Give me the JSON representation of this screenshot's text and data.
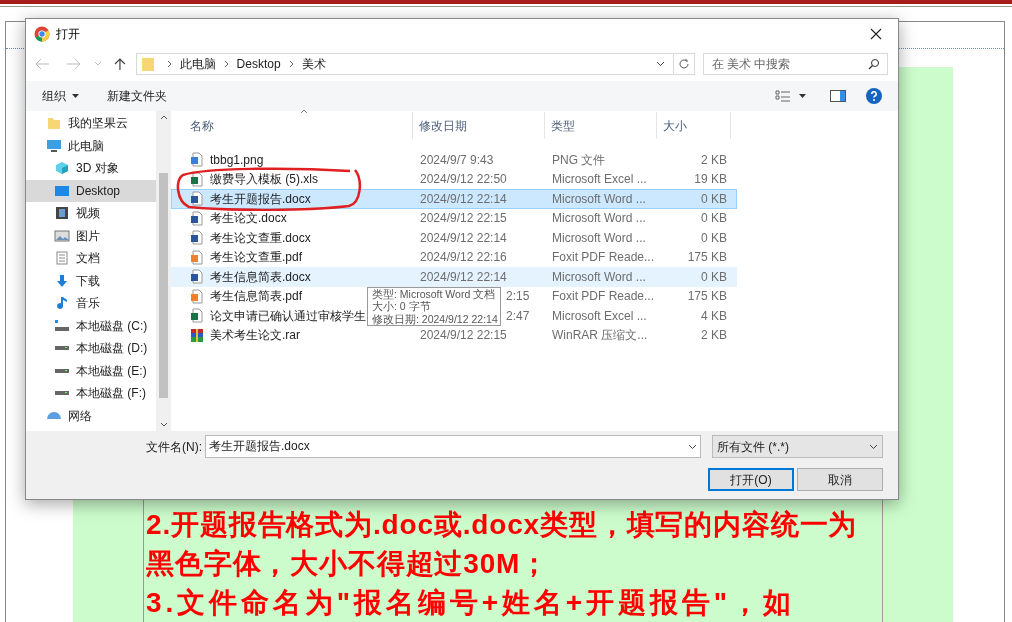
{
  "page": {
    "paragraphs": [
      {
        "text": "2.开题报告格式为.doc或.docx类型，填写的内容统一为黑色字体，大小不得超过30M；",
        "kind": "normal"
      },
      {
        "text": "3.文件命名为\"报名编号+姓名+开题报告\"，如",
        "kind": "spaced"
      }
    ]
  },
  "dialog": {
    "title": "打开",
    "path": [
      "此电脑",
      "Desktop",
      "美术"
    ],
    "search": {
      "placeholder": "在 美术 中搜索"
    },
    "toolbar": {
      "organize": "组织",
      "new_folder": "新建文件夹"
    },
    "sidebar": [
      {
        "label": "我的坚果云",
        "kind": "folder",
        "selected": false
      },
      {
        "label": "此电脑",
        "kind": "pc",
        "selected": false,
        "children": [
          {
            "label": "3D 对象",
            "kind": "cube",
            "selected": false
          },
          {
            "label": "Desktop",
            "kind": "desktop",
            "selected": true
          },
          {
            "label": "视频",
            "kind": "video",
            "selected": false
          },
          {
            "label": "图片",
            "kind": "picture",
            "selected": false
          },
          {
            "label": "文档",
            "kind": "doc",
            "selected": false
          },
          {
            "label": "下载",
            "kind": "download",
            "selected": false
          },
          {
            "label": "音乐",
            "kind": "music",
            "selected": false
          },
          {
            "label": "本地磁盘 (C:)",
            "kind": "system",
            "selected": false
          },
          {
            "label": "本地磁盘 (D:)",
            "kind": "drive",
            "selected": false
          },
          {
            "label": "本地磁盘 (E:)",
            "kind": "drive",
            "selected": false
          },
          {
            "label": "本地磁盘 (F:)",
            "kind": "drive",
            "selected": false
          }
        ]
      },
      {
        "label": "网络",
        "kind": "network",
        "selected": false
      }
    ],
    "columns": [
      "名称",
      "修改日期",
      "类型",
      "大小"
    ],
    "files": [
      {
        "name": "tbbg1.png",
        "date": "2024/9/7 9:43",
        "type": "PNG 文件",
        "size": "2 KB",
        "kind": "image",
        "selected": false,
        "hovered": false,
        "under_tooltip": false
      },
      {
        "name": "缴费导入模板 (5).xls",
        "date": "2024/9/12 22:50",
        "type": "Microsoft Excel ...",
        "size": "19 KB",
        "kind": "excel",
        "selected": false,
        "hovered": false,
        "under_tooltip": false
      },
      {
        "name": "考生开题报告.docx",
        "date": "2024/9/12 22:14",
        "type": "Microsoft Word ...",
        "size": "0 KB",
        "kind": "word",
        "selected": true,
        "hovered": false,
        "under_tooltip": false
      },
      {
        "name": "考生论文.docx",
        "date": "2024/9/12 22:15",
        "type": "Microsoft Word ...",
        "size": "0 KB",
        "kind": "word",
        "selected": false,
        "hovered": false,
        "under_tooltip": false
      },
      {
        "name": "考生论文查重.docx",
        "date": "2024/9/12 22:14",
        "type": "Microsoft Word ...",
        "size": "0 KB",
        "kind": "word",
        "selected": false,
        "hovered": false,
        "under_tooltip": false
      },
      {
        "name": "考生论文查重.pdf",
        "date": "2024/9/12 22:16",
        "type": "Foxit PDF Reade...",
        "size": "175 KB",
        "kind": "pdf",
        "selected": false,
        "hovered": false,
        "under_tooltip": false
      },
      {
        "name": "考生信息简表.docx",
        "date": "2024/9/12 22:14",
        "type": "Microsoft Word ...",
        "size": "0 KB",
        "kind": "word",
        "selected": false,
        "hovered": true,
        "under_tooltip": false
      },
      {
        "name": "考生信息简表.pdf",
        "date": "2:15",
        "type": "Foxit PDF Reade...",
        "size": "175 KB",
        "kind": "pdf",
        "selected": false,
        "hovered": false,
        "under_tooltip": true
      },
      {
        "name": "论文申请已确认通过审核学生",
        "date": "2:47",
        "type": "Microsoft Excel ...",
        "size": "4 KB",
        "kind": "excel",
        "selected": false,
        "hovered": false,
        "under_tooltip": true
      },
      {
        "name": "美术考生论文.rar",
        "date": "2024/9/12 22:15",
        "type": "WinRAR 压缩文...",
        "size": "2 KB",
        "kind": "rar",
        "selected": false,
        "hovered": false,
        "under_tooltip": false
      }
    ],
    "tooltip": [
      "类型: Microsoft Word 文档",
      "大小: 0 字节",
      "修改日期: 2024/9/12 22:14"
    ],
    "filename_label": "文件名(N):",
    "filename_value": "考生开题报告.docx",
    "filetype": "所有文件 (*.*)",
    "buttons": [
      {
        "label": "打开(O)",
        "kind": "default"
      },
      {
        "label": "取消",
        "kind": "normal"
      }
    ]
  }
}
